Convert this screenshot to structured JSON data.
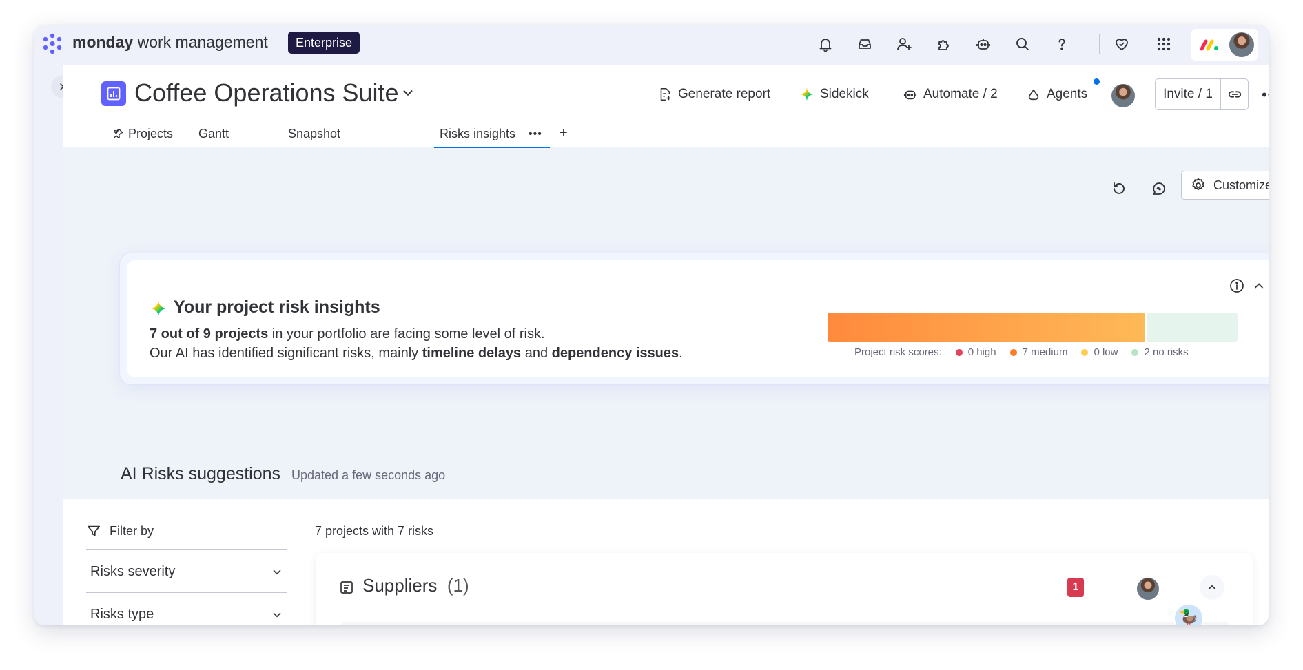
{
  "topbar": {
    "brand_bold": "monday",
    "brand_rest": " work management",
    "plan_badge": "Enterprise",
    "icons": [
      "bell-icon",
      "inbox-icon",
      "invite-member-icon",
      "apps-icon",
      "ai-robot-icon",
      "search-icon",
      "help-icon",
      "heart-icon",
      "grid-menu-icon"
    ]
  },
  "board": {
    "title": "Coffee Operations Suite",
    "actions": {
      "generate_report": "Generate report",
      "sidekick": "Sidekick",
      "automate": "Automate / 2",
      "agents": "Agents"
    },
    "invite_label": "Invite / 1",
    "more_label": "•••"
  },
  "tabs": [
    {
      "label": "Projects",
      "pinned": true
    },
    {
      "label": "Gantt"
    },
    {
      "label": "Snapshot"
    },
    {
      "label": "Risks insights",
      "active": true
    }
  ],
  "tab_more": "•••",
  "tab_add": "+",
  "toolbar": {
    "customize": "Customize"
  },
  "insights": {
    "title": "Your project risk insights",
    "line1_bold": "7 out of 9 projects",
    "line1_rest": " in your portfolio are facing some level of risk.",
    "line2_pre": "Our AI has identified significant risks, mainly ",
    "line2_bold1": "timeline delays",
    "line2_mid": " and ",
    "line2_bold2": "dependency issues",
    "line2_end": ".",
    "scores_label": "Project risk scores:",
    "scores": [
      {
        "label": "0 high",
        "count": 0,
        "color": "#e2445c"
      },
      {
        "label": "7 medium",
        "count": 7,
        "color": "#ff7b24"
      },
      {
        "label": "0 low",
        "count": 0,
        "color": "#ffcb52"
      },
      {
        "label": "2 no risks",
        "count": 2,
        "color": "#b9e2c9"
      }
    ]
  },
  "suggestions": {
    "title": "AI Risks suggestions",
    "updated": "Updated a few seconds ago",
    "filter_label": "Filter by",
    "filters": [
      "Risks severity",
      "Risks type"
    ],
    "summary": "7 projects with 7 risks",
    "group": {
      "name": "Suppliers",
      "count_label": "(1)",
      "badge": "1"
    }
  },
  "colors": {
    "accent": "#0073ea",
    "brand_purple": "#6161ff",
    "enterprise_bg": "#1f1a44",
    "badge_red": "#d83a52"
  }
}
